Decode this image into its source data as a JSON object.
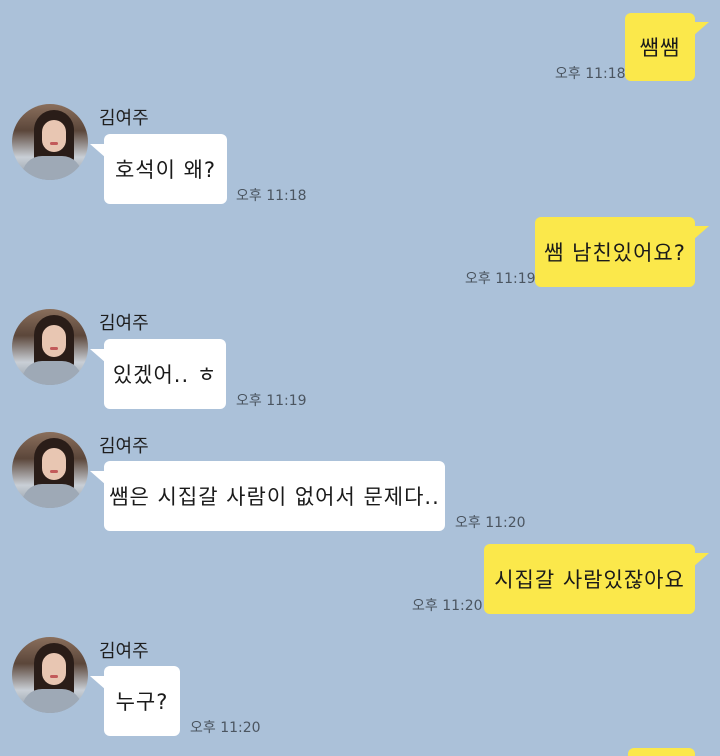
{
  "contact": {
    "name": "김여주"
  },
  "colors": {
    "background": "#abc1d9",
    "my_bubble": "#fbe84b",
    "their_bubble": "#ffffff"
  },
  "messages": [
    {
      "sender": "me",
      "text": "쌤쌤",
      "time": "오후 11:18"
    },
    {
      "sender": "them",
      "text": "호석이 왜?",
      "time": "오후 11:18"
    },
    {
      "sender": "me",
      "text": "쌤 남친있어요?",
      "time": "오후 11:19"
    },
    {
      "sender": "them",
      "text": "있겠어.. ㅎ",
      "time": "오후 11:19"
    },
    {
      "sender": "them",
      "text": "쌤은 시집갈 사람이 없어서 문제다..",
      "time": "오후 11:20"
    },
    {
      "sender": "me",
      "text": "시집갈 사람있잖아요",
      "time": "오후 11:20"
    },
    {
      "sender": "them",
      "text": "누구?",
      "time": "오후 11:20"
    }
  ]
}
